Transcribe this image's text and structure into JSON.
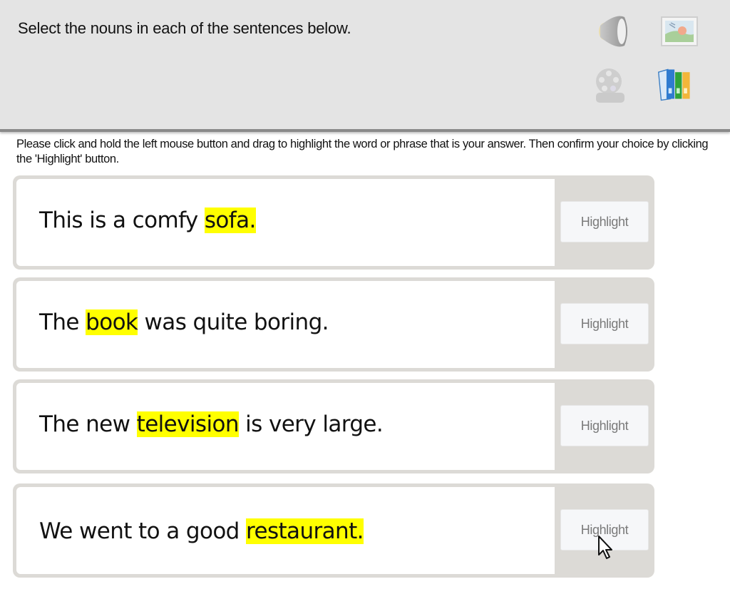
{
  "header": {
    "question": "Select the nouns in each of the sentences below.",
    "icons": [
      "speaker-icon",
      "image-icon",
      "video-reel-icon",
      "library-books-icon"
    ]
  },
  "instructions": "Please click and hold the left mouse button and drag to highlight the word or phrase that is your answer. Then confirm your choice by clicking the 'Highlight' button.",
  "highlight_color": "#ffff00",
  "items": [
    {
      "before": "This is a comfy ",
      "highlighted": "sofa.",
      "after": "",
      "button": "Highlight"
    },
    {
      "before": "The ",
      "highlighted": "book",
      "after": " was quite boring.",
      "button": "Highlight"
    },
    {
      "before": "The new ",
      "highlighted": "television",
      "after": " is very large.",
      "button": "Highlight"
    },
    {
      "before": "We went to a good ",
      "highlighted": "restaurant.",
      "after": "",
      "button": "Highlight"
    }
  ]
}
